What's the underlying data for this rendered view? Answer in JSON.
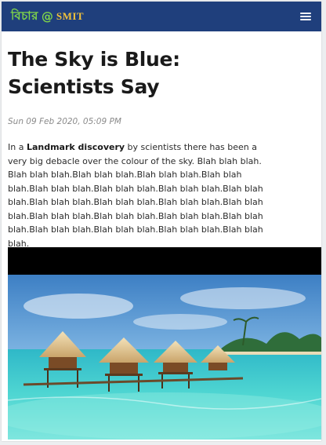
{
  "header": {
    "logo_script": "বিচার",
    "logo_at": "@",
    "logo_brand": "SMIT",
    "menu_icon": "hamburger-menu-icon",
    "background_color": "#1f3f7c",
    "logo_green": "#7fd34a",
    "logo_gold": "#f2c23a"
  },
  "article": {
    "title": "The Sky is Blue: Scientists Say",
    "dateline": "Sun 09 Feb 2020, 05:09 PM",
    "body_prefix": "In a ",
    "body_link": "Landmark discovery",
    "body_rest": " by scientists there has been a very big debacle over the colour of the sky. Blah blah blah. Blah blah blah.Blah blah blah.Blah blah blah.Blah blah blah.Blah blah blah.Blah blah blah.Blah blah blah.Blah blah blah.Blah blah blah.Blah blah blah.Blah blah blah.Blah blah blah.Blah blah blah.Blah blah blah.Blah blah blah.Blah blah blah.Blah blah blah.Blah blah blah.Blah blah blah.Blah blah blah.",
    "image_subject": "tropical-overwater-bungalows-photo"
  }
}
